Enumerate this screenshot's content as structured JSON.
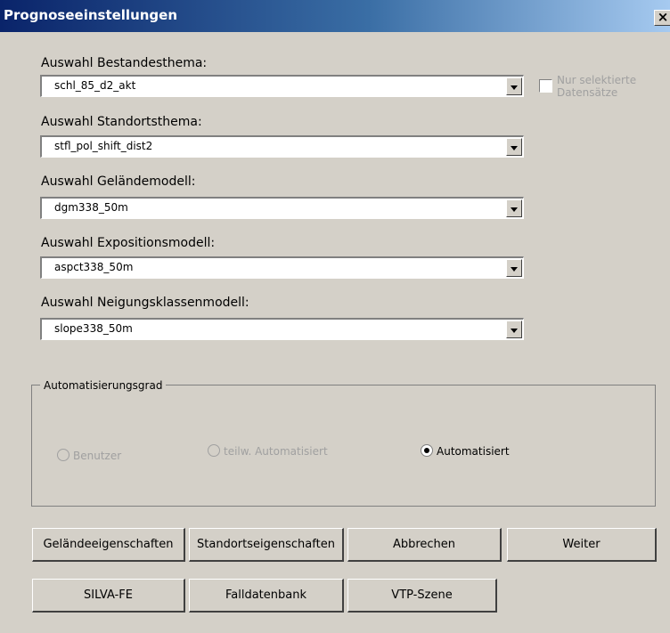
{
  "window": {
    "title": "Prognoseeinstellungen",
    "close_label": "×"
  },
  "fields": [
    {
      "label": "Auswahl Bestandesthema:",
      "value": "schl_85_d2_akt"
    },
    {
      "label": "Auswahl Standortsthema:",
      "value": "stfl_pol_shift_dist2"
    },
    {
      "label": "Auswahl Geländemodell:",
      "value": "dgm338_50m"
    },
    {
      "label": "Auswahl Expositionsmodell:",
      "value": "aspct338_50m"
    },
    {
      "label": "Auswahl Neigungsklassenmodell:",
      "value": "slope338_50m"
    }
  ],
  "checkbox": {
    "label": "Nur selektierte Datensätze",
    "checked": false,
    "enabled": false
  },
  "group": {
    "label": "Automatisierungsgrad",
    "options": [
      {
        "label": "Benutzer",
        "enabled": false,
        "selected": false
      },
      {
        "label": "teilw. Automatisiert",
        "enabled": false,
        "selected": false
      },
      {
        "label": "Automatisiert",
        "enabled": true,
        "selected": true
      }
    ]
  },
  "buttons": {
    "gelaende": "Geländeeigenschaften",
    "standort": "Standortseigenschaften",
    "abbrechen": "Abbrechen",
    "weiter": "Weiter",
    "silva": "SILVA-FE",
    "falldaten": "Falldatenbank",
    "vtp": "VTP-Szene"
  }
}
